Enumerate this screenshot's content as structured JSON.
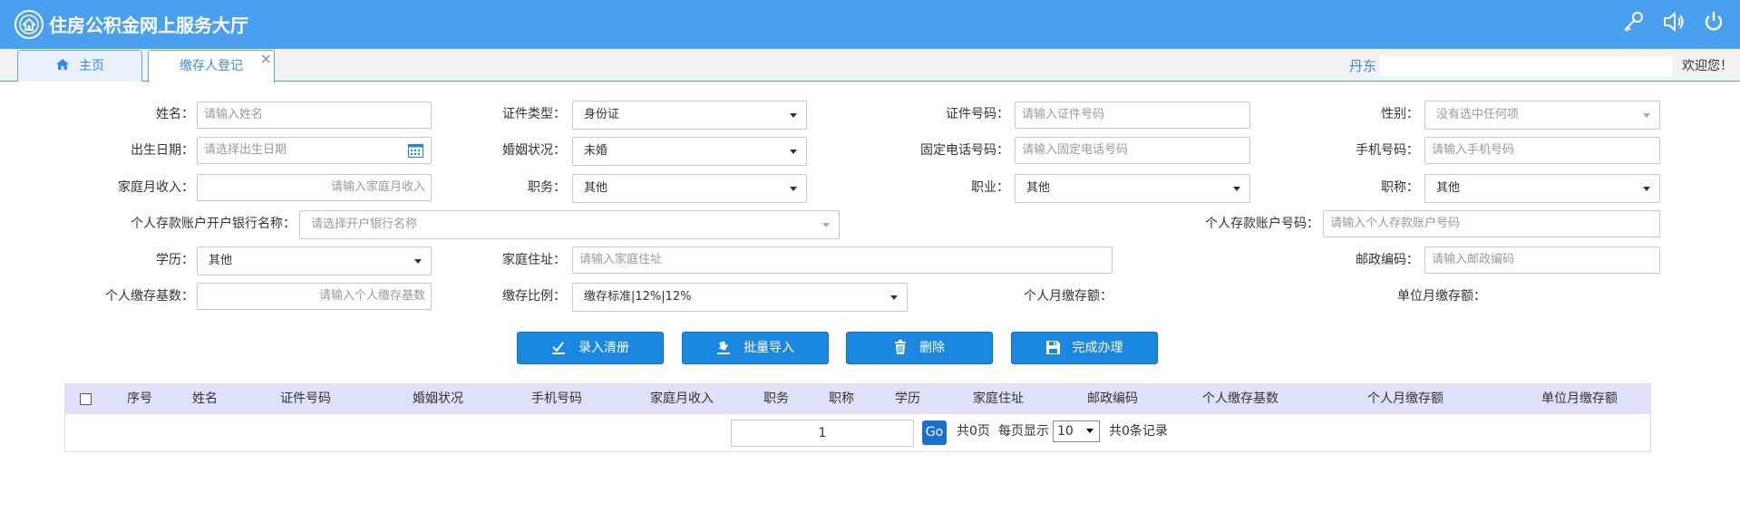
{
  "header": {
    "title": "住房公积金网上服务大厅",
    "icons": [
      "key-icon",
      "volume-icon",
      "power-icon"
    ]
  },
  "tabs": {
    "home": "主页",
    "current": "缴存人登记",
    "close": "×"
  },
  "user": {
    "name": "丹东",
    "welcome": "欢迎您！"
  },
  "form": {
    "name": {
      "label": "姓名：",
      "placeholder": "请输入姓名"
    },
    "id_type": {
      "label": "证件类型：",
      "value": "身份证"
    },
    "id_number": {
      "label": "证件号码：",
      "placeholder": "请输入证件号码"
    },
    "gender": {
      "label": "性别：",
      "value": "没有选中任何项"
    },
    "birth_date": {
      "label": "出生日期：",
      "placeholder": "请选择出生日期"
    },
    "marital": {
      "label": "婚姻状况：",
      "value": "未婚"
    },
    "landline": {
      "label": "固定电话号码：",
      "placeholder": "请输入固定电话号码"
    },
    "mobile": {
      "label": "手机号码：",
      "placeholder": "请输入手机号码"
    },
    "income": {
      "label": "家庭月收入：",
      "placeholder": "请输入家庭月收入"
    },
    "duty": {
      "label": "职务：",
      "value": "其他"
    },
    "occupation": {
      "label": "职业：",
      "value": "其他"
    },
    "title": {
      "label": "职称：",
      "value": "其他"
    },
    "bank": {
      "label": "个人存款账户开户银行名称：",
      "value": "请选择开户银行名称"
    },
    "account": {
      "label": "个人存款账户号码：",
      "placeholder": "请输入个人存款账户号码"
    },
    "education": {
      "label": "学历：",
      "value": "其他"
    },
    "address": {
      "label": "家庭住址：",
      "placeholder": "请输入家庭住址"
    },
    "postcode": {
      "label": "邮政编码：",
      "placeholder": "请输入邮政编码"
    },
    "base": {
      "label": "个人缴存基数：",
      "placeholder": "请输入个人缴存基数"
    },
    "ratio": {
      "label": "缴存比例：",
      "value": "缴存标准|12%|12%"
    },
    "personal_monthly": {
      "label": "个人月缴存额："
    },
    "unit_monthly": {
      "label": "单位月缴存额："
    }
  },
  "buttons": {
    "entry_clear": "录入清册",
    "batch_import": "批量导入",
    "delete": "删除",
    "finish": "完成办理"
  },
  "table": {
    "columns": [
      "序号",
      "姓名",
      "证件号码",
      "婚姻状况",
      "手机号码",
      "家庭月收入",
      "职务",
      "职称",
      "学历",
      "家庭住址",
      "邮政编码",
      "个人缴存基数",
      "个人月缴存额",
      "单位月缴存额"
    ]
  },
  "pagination": {
    "page": "1",
    "go": "Go",
    "total_pages": "共0页",
    "per_page_label": "每页显示",
    "per_page": "10",
    "total_records": "共0条记录"
  },
  "colors": {
    "header_bg": "#4aa0ee",
    "button_bg": "#1a88e0",
    "table_head_bg": "#e0e0f8"
  }
}
